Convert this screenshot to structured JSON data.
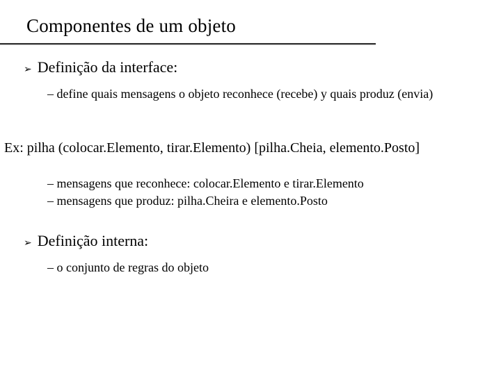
{
  "title": "Componentes de um objeto",
  "bullets": {
    "interface": {
      "label": "Definição da interface:",
      "sub1": "– define quais mensagens o objeto reconhece (recebe) y quais produz (envia)"
    },
    "internal": {
      "label": "Definição interna:",
      "sub1": "– o conjunto de regras do objeto"
    }
  },
  "example": "Ex: pilha (colocar.Elemento, tirar.Elemento) [pilha.Cheia, elemento.Posto]",
  "example_subs": {
    "line1": "– mensagens que reconhece: colocar.Elemento e tirar.Elemento",
    "line2": "– mensagens que produz: pilha.Cheira e elemento.Posto"
  },
  "icons": {
    "arrow": "➢"
  }
}
